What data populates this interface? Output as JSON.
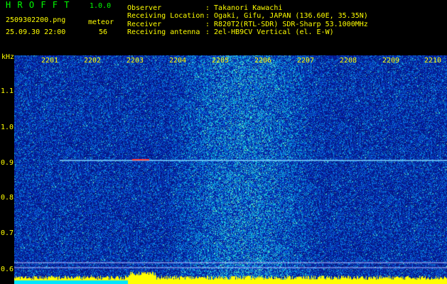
{
  "header": {
    "app_name": "H R O F F T",
    "version": "1.0.0",
    "filename": "2509302200.png",
    "mode_label": "meteor",
    "datetime": "25.09.30 22:00",
    "count": "56",
    "observer_label": "Observer",
    "observer_value": ": Takanori Kawachi",
    "location_label": "Receiving Location",
    "location_value": ": Ogaki, Gifu, JAPAN (136.60E, 35.35N)",
    "receiver_label": "Receiver",
    "receiver_value": ": R820T2(RTL-SDR) SDR-Sharp 53.1000MHz",
    "antenna_label": "Receiving antenna",
    "antenna_value": ": 2el-HB9CV Vertical (el. E-W)"
  },
  "axis": {
    "y_unit": "kHz",
    "y_ticks": [
      "1.1",
      "1.0",
      "0.9",
      "0.8",
      "0.7",
      "0.6"
    ],
    "x_ticks": [
      "2201",
      "2202",
      "2203",
      "2204",
      "2205",
      "2206",
      "2207",
      "2208",
      "2209",
      "2210"
    ]
  },
  "colors": {
    "background": "#000000",
    "text_primary": "#ffff00",
    "text_title": "#00ff00",
    "noise_low": "#0a1a8c",
    "noise_high": "#3fe0ff",
    "carrier": "#7fd7ff",
    "meteor_echo": "#ff4040"
  }
}
